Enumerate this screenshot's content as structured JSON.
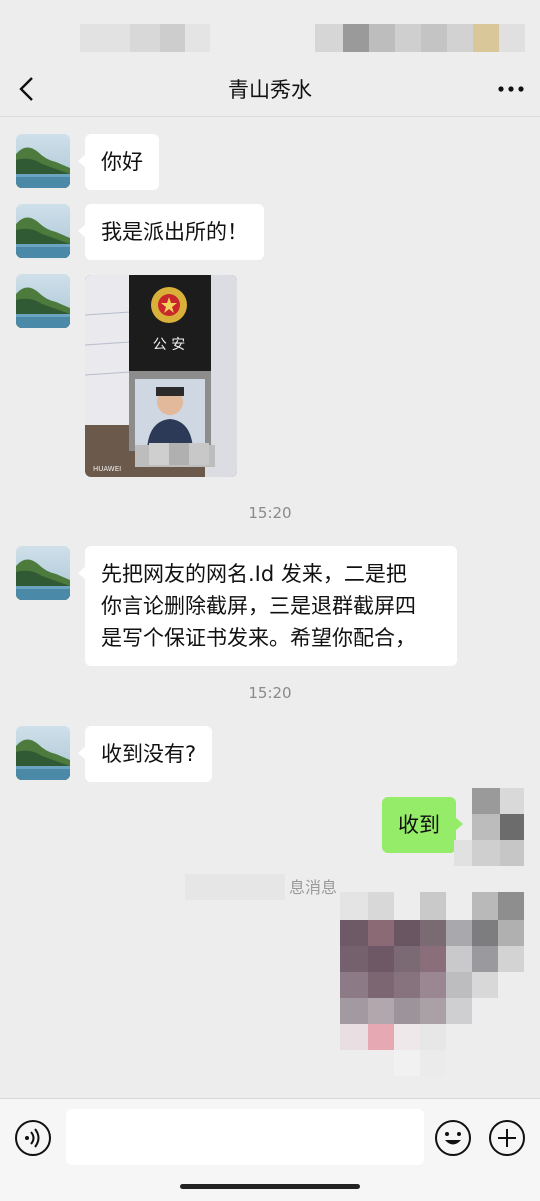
{
  "header": {
    "title": "青山秀水",
    "back_icon": "back-arrow-icon",
    "more_icon": "more-dots-icon"
  },
  "messages": [
    {
      "sender": "contact",
      "type": "text",
      "text": "你好"
    },
    {
      "sender": "contact",
      "type": "text",
      "text": "我是派出所的！"
    },
    {
      "sender": "contact",
      "type": "image",
      "image_text": "公  安",
      "watermark": "HUAWEI"
    },
    {
      "type": "time",
      "text": "15:20"
    },
    {
      "sender": "contact",
      "type": "text",
      "lines": [
        "先把网友的网名.Id 发来，二是把",
        "你言论删除截屏，三是退群截屏四",
        "是写个保证书发来。希望你配合，"
      ]
    },
    {
      "type": "time",
      "text": "15:20"
    },
    {
      "sender": "contact",
      "type": "text",
      "text": "收到没有?"
    },
    {
      "sender": "me",
      "type": "text",
      "text": "收到"
    }
  ],
  "partial_notice": "息消息",
  "input_bar": {
    "voice_icon": "voice-icon",
    "emoji_icon": "emoji-icon",
    "plus_icon": "plus-icon"
  },
  "colors": {
    "background": "#ededed",
    "incoming_bubble": "#ffffff",
    "outgoing_bubble": "#95ec69",
    "timestamp": "#8a8a8a"
  }
}
